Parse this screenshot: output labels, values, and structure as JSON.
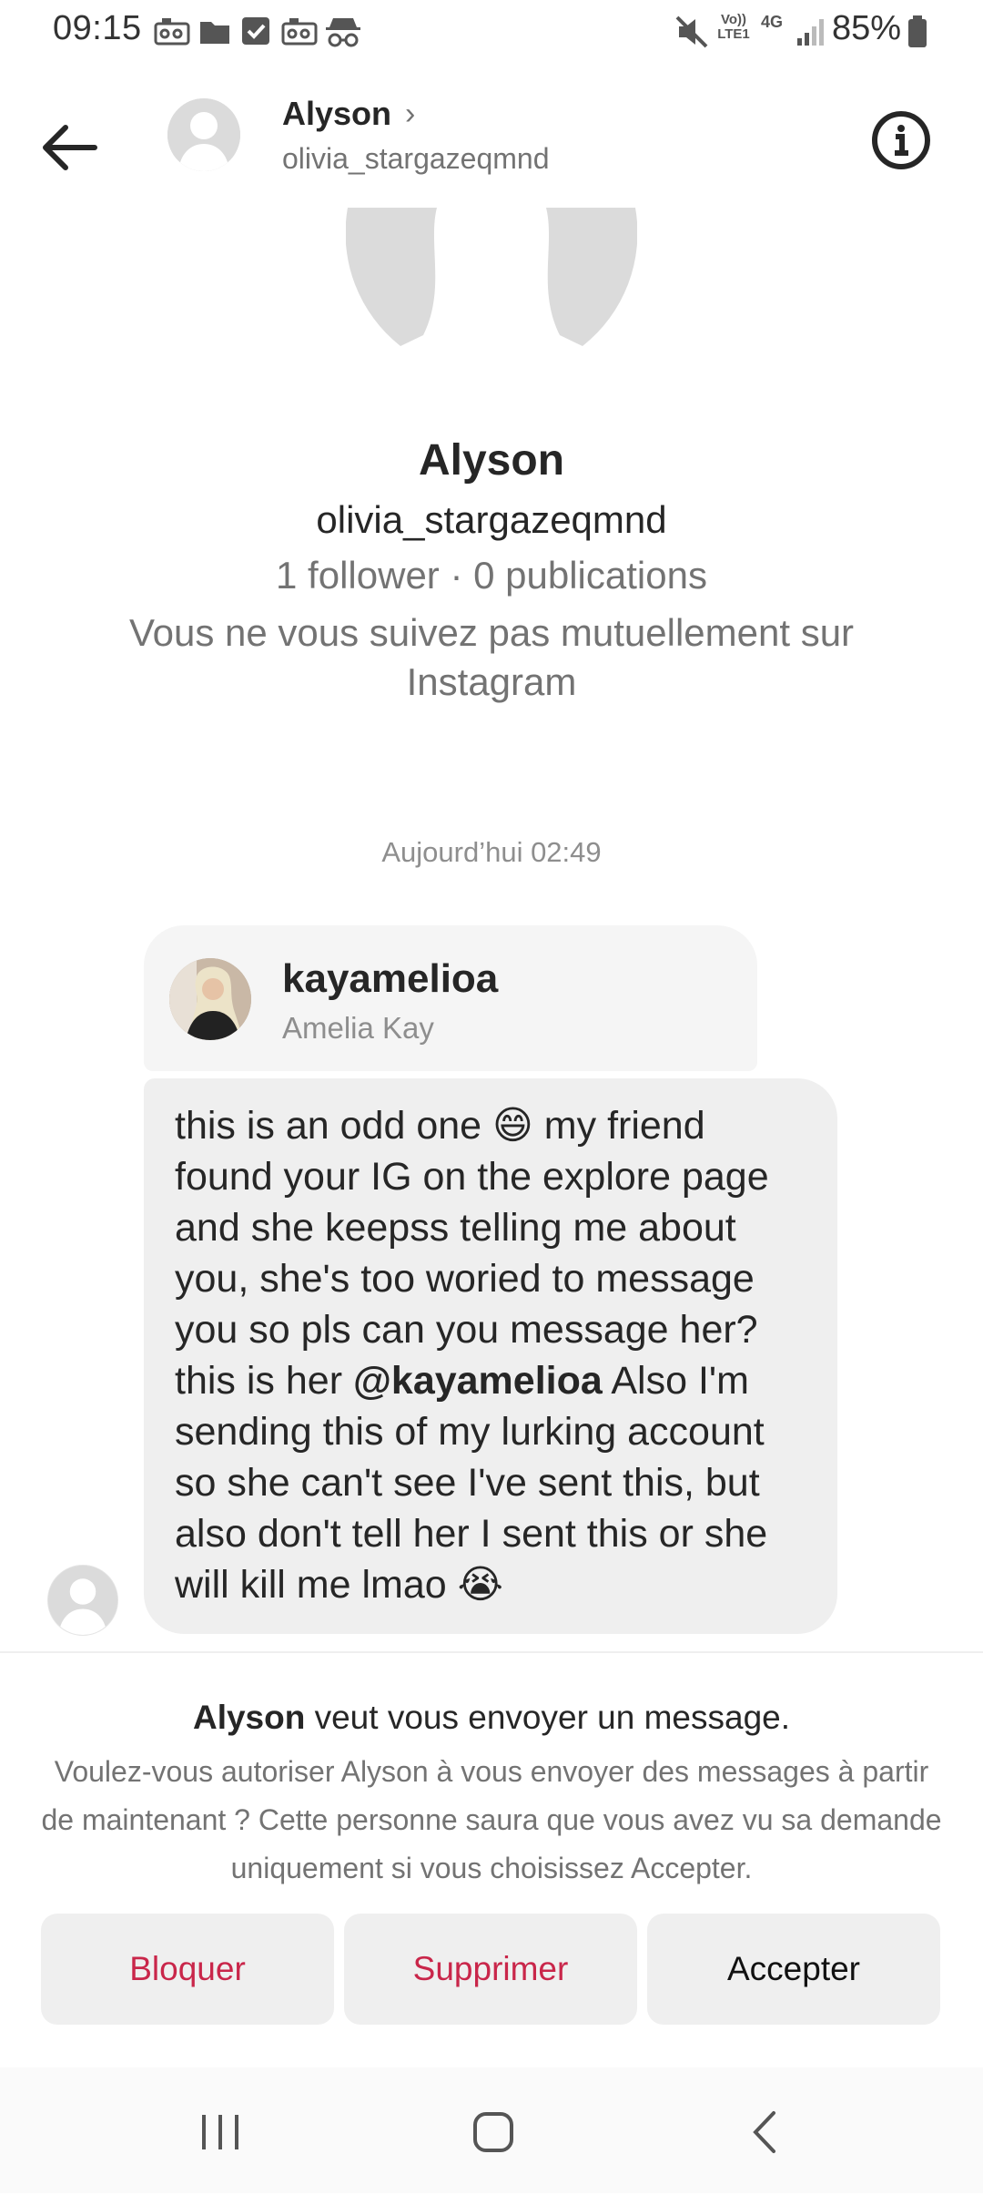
{
  "status_bar": {
    "time": "09:15",
    "battery": "85%",
    "network_label": "4G",
    "volte_label": "Vo)) LTE1",
    "icons": [
      "video-icon",
      "folder-icon",
      "checkbox-icon",
      "video-icon",
      "incognito-icon",
      "mute-icon",
      "signal-icon",
      "battery-icon"
    ]
  },
  "header": {
    "name": "Alyson",
    "username": "olivia_stargazeqmnd",
    "icons": [
      "back-arrow-icon",
      "chevron-right-icon",
      "info-icon"
    ]
  },
  "profile": {
    "name": "Alyson",
    "username": "olivia_stargazeqmnd",
    "stats": "1 follower · 0 publications",
    "mutual_notice": "Vous ne vous suivez pas mutuellement sur Instagram"
  },
  "conversation": {
    "timestamp": "Aujourd’hui 02:49",
    "shared_profile": {
      "username": "kayamelioa",
      "full_name": "Amelia Kay"
    },
    "message": {
      "part1": "this is an odd one ",
      "emoji1": "😄",
      "part2": " my friend found your IG on the explore page and she keepss telling me about you, she's too woried to message you so pls can you message her? this is her ",
      "mention": "@kayamelioa",
      "part3": " Also I'm sending this of my lurking account so she can't see I've sent this, but also don't tell her I sent this or she will kill me lmao ",
      "emoji2": "😭"
    }
  },
  "request": {
    "sender_name": "Alyson",
    "title_rest": " veut vous envoyer un message.",
    "description": "Voulez-vous autoriser Alyson à vous envoyer des messages à partir de maintenant ? Cette personne saura que vous avez vu sa demande uniquement si vous choisissez Accepter.",
    "buttons": {
      "block": "Bloquer",
      "delete": "Supprimer",
      "accept": "Accepter"
    },
    "colors": {
      "destructive": "#c9264a"
    }
  },
  "nav": {
    "icons": [
      "recent-apps-icon",
      "home-icon",
      "back-icon"
    ]
  }
}
